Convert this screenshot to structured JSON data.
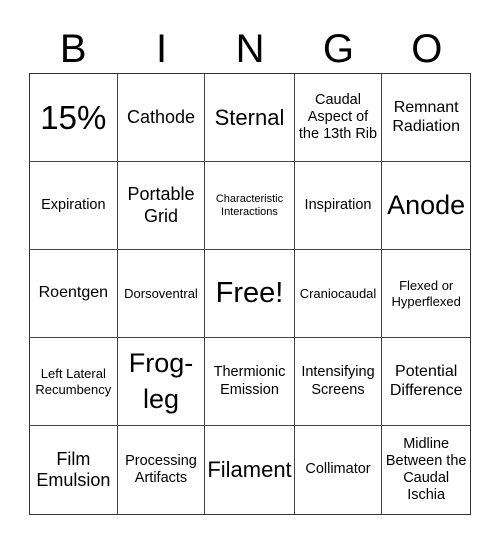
{
  "header": [
    "B",
    "I",
    "N",
    "G",
    "O"
  ],
  "cells": [
    {
      "text": "15%",
      "size": "s8"
    },
    {
      "text": "Cathode",
      "size": "s5"
    },
    {
      "text": "Sternal",
      "size": "s6"
    },
    {
      "text": "Caudal Aspect of the 13th Rib",
      "size": "s3"
    },
    {
      "text": "Remnant Radiation",
      "size": "s4"
    },
    {
      "text": "Expiration",
      "size": "s3"
    },
    {
      "text": "Portable Grid",
      "size": "s5"
    },
    {
      "text": "Characteristic Interactions",
      "size": "s1"
    },
    {
      "text": "Inspiration",
      "size": "s3"
    },
    {
      "text": "Anode",
      "size": "s7"
    },
    {
      "text": "Roentgen",
      "size": "s4"
    },
    {
      "text": "Dorsoventral",
      "size": "s2"
    },
    {
      "text": "Free!",
      "size": "s9"
    },
    {
      "text": "Craniocaudal",
      "size": "s2"
    },
    {
      "text": "Flexed or Hyperflexed",
      "size": "s2"
    },
    {
      "text": "Left Lateral Recumbency",
      "size": "s2"
    },
    {
      "text": "Frog-leg",
      "size": "s7",
      "wrap": true
    },
    {
      "text": "Thermionic Emission",
      "size": "s3"
    },
    {
      "text": "Intensifying Screens",
      "size": "s3"
    },
    {
      "text": "Potential Difference",
      "size": "s4"
    },
    {
      "text": "Film Emulsion",
      "size": "s5"
    },
    {
      "text": "Processing Artifacts",
      "size": "s3"
    },
    {
      "text": "Filament",
      "size": "s6"
    },
    {
      "text": "Collimator",
      "size": "s3"
    },
    {
      "text": "Midline Between the Caudal Ischia",
      "size": "s3"
    }
  ]
}
